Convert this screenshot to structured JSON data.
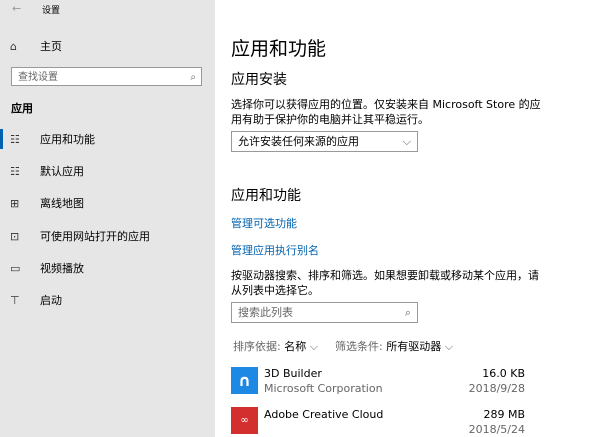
{
  "window": {
    "back": "←",
    "title": "设置"
  },
  "sidebar": {
    "home": "主页",
    "search_placeholder": "查找设置",
    "section": "应用",
    "items": [
      {
        "label": "应用和功能",
        "icon": "☷"
      },
      {
        "label": "默认应用",
        "icon": "☷"
      },
      {
        "label": "离线地图",
        "icon": "⊞"
      },
      {
        "label": "可使用网站打开的应用",
        "icon": "⊡"
      },
      {
        "label": "视频播放",
        "icon": "▭"
      },
      {
        "label": "启动",
        "icon": "⊤"
      }
    ]
  },
  "main": {
    "title": "应用和功能",
    "install_heading": "应用安装",
    "install_desc": "选择你可以获得应用的位置。仅安装来自 Microsoft Store 的应用有助于保护你的电脑并让其平稳运行。",
    "install_select": "允许安装任何来源的应用",
    "apps_heading": "应用和功能",
    "link1": "管理可选功能",
    "link2": "管理应用执行别名",
    "apps_desc": "按驱动器搜索、排序和筛选。如果想要卸载或移动某个应用，请从列表中选择它。",
    "search_placeholder": "搜索此列表",
    "sort_label": "排序依据:",
    "sort_value": "名称",
    "filter_label": "筛选条件:",
    "filter_value": "所有驱动器",
    "apps": [
      {
        "name": "3D Builder",
        "publisher": "Microsoft Corporation",
        "size": "16.0 KB",
        "date": "2018/9/28",
        "color": "#1e88e5"
      },
      {
        "name": "Adobe Creative Cloud",
        "publisher": "",
        "size": "289 MB",
        "date": "2018/5/24",
        "color": "#d32f2f"
      }
    ]
  }
}
